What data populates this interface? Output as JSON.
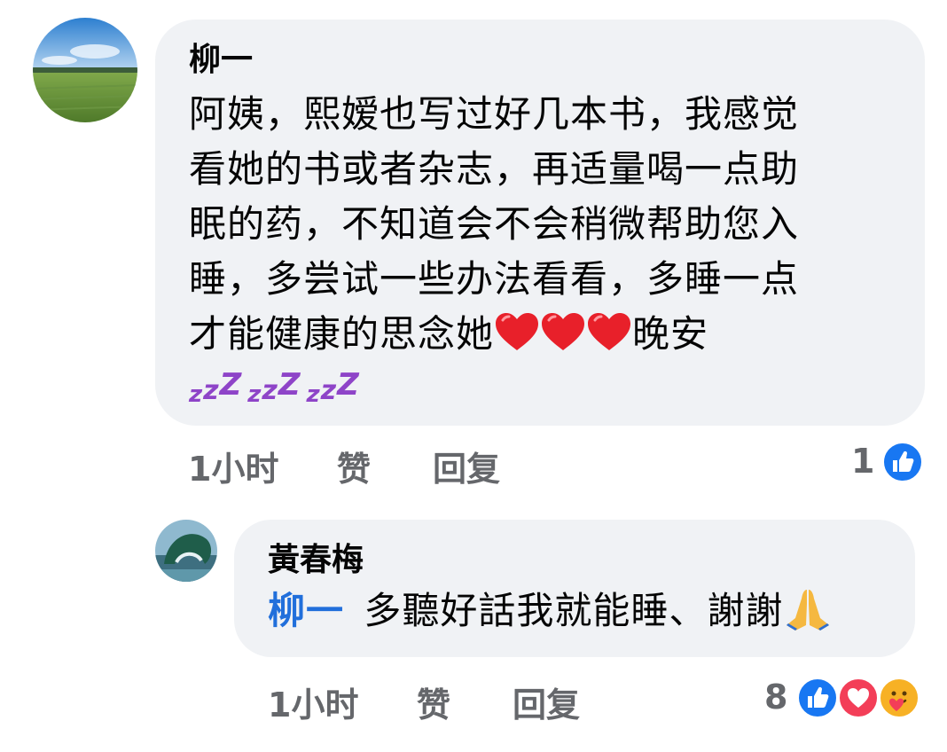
{
  "comments": [
    {
      "author": "柳一",
      "text_lines": [
        "阿姨，熙嫒也写过好几本书，我感觉",
        "看她的书或者杂志，再适量喝一点助",
        "眠的药，不知道会不会稍微帮助您入",
        "睡，多尝试一些办法看看，多睡一点"
      ],
      "last_line_before": "才能健康的思念她",
      "last_line_after": "晚安",
      "emojis": [
        "heart-emoji",
        "heart-emoji",
        "heart-emoji"
      ],
      "trailing_emojis": [
        "zzz-emoji",
        "zzz-emoji",
        "zzz-emoji"
      ],
      "zzz_glyph": {
        "a": "z",
        "b": "z",
        "c": "Z"
      },
      "time": "1小时",
      "like_label": "赞",
      "reply_label": "回复",
      "reaction_count": "1",
      "reactions": [
        "like-reaction"
      ]
    },
    {
      "author": "黃春梅",
      "mention": "柳一",
      "text": "多聽好話我就能睡、謝謝",
      "emojis": [
        "pray-emoji"
      ],
      "time": "1小时",
      "like_label": "赞",
      "reply_label": "回复",
      "reaction_count": "8",
      "reactions": [
        "like-reaction",
        "love-reaction",
        "care-reaction"
      ]
    }
  ],
  "colors": {
    "bubble": "#f0f2f5",
    "meta_text": "#65676b",
    "mention": "#216fdb",
    "like_blue": "#1877f2",
    "love_red": "#f33e58",
    "care_yellow": "#f7b125"
  }
}
